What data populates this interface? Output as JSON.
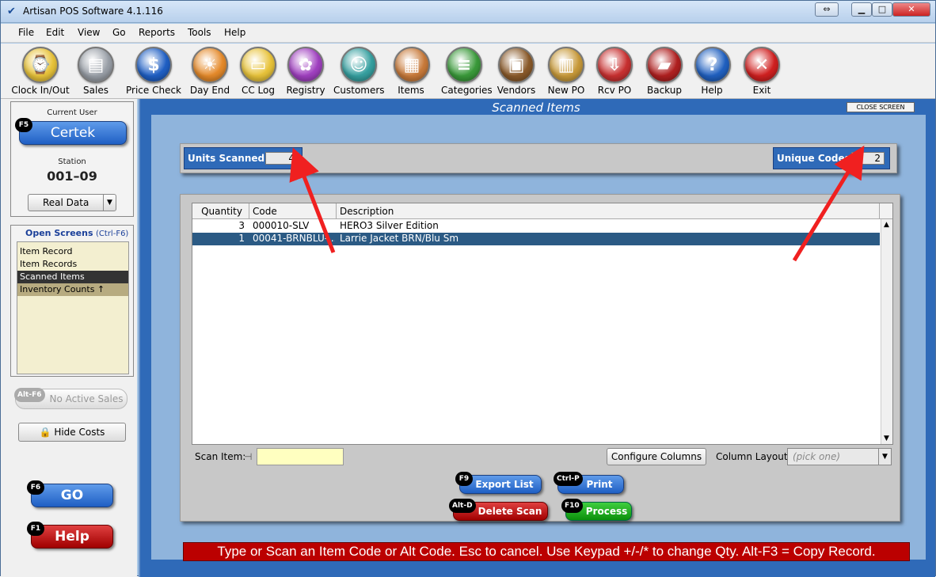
{
  "window": {
    "title": "Artisan POS Software 4.1.116"
  },
  "menu": [
    "File",
    "Edit",
    "View",
    "Go",
    "Reports",
    "Tools",
    "Help"
  ],
  "toolbar": [
    {
      "label": "Clock In/Out",
      "icon": "clock-in-icon",
      "color": "#e8c33a"
    },
    {
      "label": "Sales",
      "icon": "cash-register-icon",
      "color": "#9aa0a8"
    },
    {
      "label": "Price Check",
      "icon": "dollar-icon",
      "color": "#1f5fc4"
    },
    {
      "label": "Day End",
      "icon": "sunset-icon",
      "color": "#e58a2a"
    },
    {
      "label": "CC Log",
      "icon": "credit-card-icon",
      "color": "#e8c33a"
    },
    {
      "label": "Registry",
      "icon": "gift-icon",
      "color": "#a040c0"
    },
    {
      "label": "Customers",
      "icon": "customer-icon",
      "color": "#36a0a0"
    },
    {
      "label": "Items",
      "icon": "items-icon",
      "color": "#c87a3a"
    },
    {
      "label": "Categories",
      "icon": "categories-icon",
      "color": "#3a9a3a"
    },
    {
      "label": "Vendors",
      "icon": "vendor-icon",
      "color": "#8a5a2a"
    },
    {
      "label": "New PO",
      "icon": "box-icon",
      "color": "#c89a3a"
    },
    {
      "label": "Rcv PO",
      "icon": "receive-icon",
      "color": "#c83030"
    },
    {
      "label": "Backup",
      "icon": "usb-drive-icon",
      "color": "#b02020"
    },
    {
      "label": "Help",
      "icon": "help-icon",
      "color": "#2060c0"
    },
    {
      "label": "Exit",
      "icon": "exit-icon",
      "color": "#d02020"
    }
  ],
  "left": {
    "current_user_label": "Current User",
    "user_key": "F5",
    "user": "Certek",
    "station_label": "Station",
    "station": "001–09",
    "data_select": "Real Data",
    "open_screens_title": "Open Screens",
    "open_screens_hint": "(Ctrl-F6)",
    "open_screens": [
      "Item Record",
      "Item Records",
      "Scanned Items",
      "Inventory Counts ↑"
    ],
    "no_sales_key": "Alt-F6",
    "no_sales": "No Active Sales",
    "hide_costs": "Hide Costs",
    "go_key": "F6",
    "go": "GO",
    "help_key": "F1",
    "help": "Help"
  },
  "screen": {
    "title": "Scanned Items",
    "close": "CLOSE SCREEN",
    "units_label": "Units Scanned:",
    "units_value": "4",
    "unique_label": "Unique Codes:",
    "unique_value": "2",
    "columns": [
      "Quantity",
      "Code",
      "Description"
    ],
    "rows": [
      {
        "qty": "3",
        "code": "000010-SLV",
        "desc": "HERO3 Silver Edition"
      },
      {
        "qty": "1",
        "code": "00041-BRNBLU-...",
        "desc": "Larrie Jacket BRN/Blu Sm"
      }
    ],
    "scan_label": "Scan Item:",
    "scan_value": "",
    "configure": "Configure Columns",
    "layout_label": "Column Layout:",
    "layout_value": "(pick one)",
    "export_key": "F9",
    "export": "Export List",
    "print_key": "Ctrl-P",
    "print": "Print",
    "delete_key": "Alt-D",
    "delete": "Delete Scan",
    "process_key": "F10",
    "process": "Process",
    "message": "Type or Scan an Item Code or Alt Code. Esc to cancel. Use Keypad +/-/* to change Qty. Alt-F3 = Copy Record."
  }
}
